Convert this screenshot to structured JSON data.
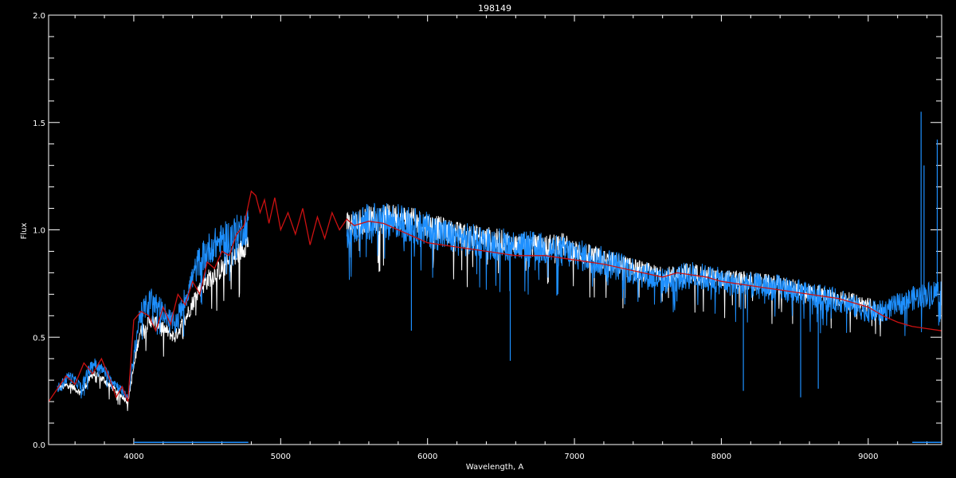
{
  "chart_data": {
    "type": "line",
    "title": "198149",
    "xlabel": "Wavelength, A",
    "ylabel": "Flux",
    "xlim": [
      3420,
      9500
    ],
    "ylim": [
      0.0,
      2.0
    ],
    "x_ticks": [
      4000,
      5000,
      6000,
      7000,
      8000,
      9000
    ],
    "x_tick_labels": [
      "4000",
      "5000",
      "6000",
      "7000",
      "8000",
      "9000"
    ],
    "y_ticks": [
      0.0,
      0.5,
      1.0,
      1.5,
      2.0
    ],
    "y_tick_labels": [
      "0.0",
      "0.5",
      "1.0",
      "1.5",
      "2.0"
    ],
    "grid": false,
    "background": "#000000",
    "series": [
      {
        "color": "#ffffff",
        "segments": [
          {
            "x": [
              3480,
              3560,
              3640,
              3720,
              3800,
              3880,
              3960,
              4040,
              4120,
              4200,
              4280,
              4360,
              4440,
              4520,
              4600,
              4680,
              4780
            ],
            "y": [
              0.26,
              0.28,
              0.24,
              0.33,
              0.3,
              0.25,
              0.2,
              0.52,
              0.58,
              0.54,
              0.5,
              0.6,
              0.72,
              0.78,
              0.82,
              0.86,
              0.95
            ]
          },
          {
            "x": [
              5450,
              5600,
              5800,
              6000,
              6200,
              6400,
              6600,
              6800,
              6900,
              7000,
              7200,
              7400,
              7600,
              7800,
              8000,
              8200,
              8400,
              8600,
              8800,
              9000,
              9100
            ],
            "y": [
              1.02,
              1.05,
              1.06,
              1.02,
              0.98,
              0.96,
              0.93,
              0.92,
              0.94,
              0.9,
              0.86,
              0.82,
              0.78,
              0.8,
              0.77,
              0.76,
              0.74,
              0.71,
              0.68,
              0.65,
              0.6
            ]
          }
        ],
        "noise": 0.05
      },
      {
        "color": "#1e90ff",
        "segments": [
          {
            "x": [
              3480,
              3560,
              3640,
              3720,
              3800,
              3880,
              3960,
              4040,
              4120,
              4200,
              4280,
              4360,
              4440,
              4520,
              4600,
              4680,
              4780
            ],
            "y": [
              0.26,
              0.32,
              0.27,
              0.38,
              0.34,
              0.28,
              0.22,
              0.6,
              0.68,
              0.62,
              0.56,
              0.7,
              0.85,
              0.92,
              0.95,
              0.98,
              1.02
            ]
          },
          {
            "x": [
              5450,
              5600,
              5800,
              6000,
              6200,
              6400,
              6600,
              6800,
              7000,
              7200,
              7400,
              7600,
              7800,
              8000,
              8200,
              8400,
              8600,
              8800,
              9000,
              9100,
              9200,
              9300,
              9400,
              9500
            ],
            "y": [
              1.0,
              1.04,
              1.04,
              1.0,
              0.96,
              0.94,
              0.93,
              0.91,
              0.89,
              0.85,
              0.81,
              0.76,
              0.79,
              0.76,
              0.74,
              0.73,
              0.7,
              0.67,
              0.62,
              0.62,
              0.65,
              0.68,
              0.7,
              0.72
            ]
          }
        ],
        "noise": 0.07,
        "spikes": [
          {
            "x": 5890,
            "y": 0.53
          },
          {
            "x": 6563,
            "y": 0.39
          },
          {
            "x": 8150,
            "y": 0.25
          },
          {
            "x": 8540,
            "y": 0.22
          },
          {
            "x": 8660,
            "y": 0.26
          },
          {
            "x": 9360,
            "y": 1.55
          },
          {
            "x": 9380,
            "y": 1.3
          },
          {
            "x": 9470,
            "y": 1.42
          }
        ],
        "baseline": [
          {
            "x": [
              4000,
              4780
            ],
            "y": 0.01
          },
          {
            "x": [
              9300,
              9500
            ],
            "y": 0.01
          }
        ]
      },
      {
        "color": "#cc1111",
        "x": [
          3420,
          3480,
          3540,
          3600,
          3660,
          3720,
          3780,
          3840,
          3880,
          3920,
          3960,
          4000,
          4050,
          4100,
          4150,
          4200,
          4250,
          4300,
          4350,
          4400,
          4450,
          4500,
          4550,
          4600,
          4650,
          4700,
          4750,
          4800,
          4830,
          4860,
          4890,
          4920,
          4960,
          5000,
          5050,
          5100,
          5150,
          5200,
          5250,
          5300,
          5350,
          5400,
          5450,
          5500,
          5600,
          5700,
          5800,
          5900,
          6000,
          6200,
          6400,
          6600,
          6800,
          7000,
          7200,
          7400,
          7600,
          7700,
          7800,
          7900,
          8000,
          8200,
          8400,
          8600,
          8800,
          9000,
          9100,
          9200,
          9300,
          9400,
          9500
        ],
        "y": [
          0.2,
          0.26,
          0.32,
          0.28,
          0.38,
          0.33,
          0.4,
          0.3,
          0.22,
          0.27,
          0.2,
          0.58,
          0.62,
          0.6,
          0.53,
          0.64,
          0.56,
          0.7,
          0.65,
          0.76,
          0.7,
          0.85,
          0.82,
          0.9,
          0.88,
          0.98,
          1.02,
          1.18,
          1.16,
          1.08,
          1.14,
          1.03,
          1.15,
          1.0,
          1.08,
          0.98,
          1.1,
          0.93,
          1.06,
          0.96,
          1.08,
          1.0,
          1.05,
          1.02,
          1.04,
          1.03,
          1.0,
          0.97,
          0.94,
          0.92,
          0.9,
          0.88,
          0.88,
          0.86,
          0.84,
          0.81,
          0.78,
          0.8,
          0.79,
          0.78,
          0.76,
          0.74,
          0.72,
          0.7,
          0.68,
          0.64,
          0.6,
          0.57,
          0.55,
          0.54,
          0.53
        ]
      }
    ]
  }
}
